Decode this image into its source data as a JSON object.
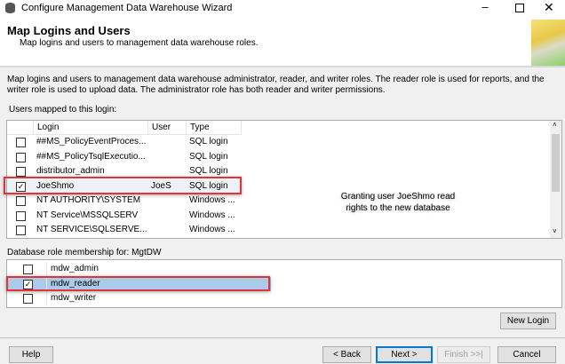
{
  "window": {
    "title": "Configure Management Data Warehouse Wizard"
  },
  "header": {
    "title": "Map Logins and Users",
    "subtitle": "Map logins and users to management data warehouse roles."
  },
  "description": "Map logins and users to management data warehouse administrator, reader, and writer roles. The reader role is used for reports, and the writer role is used to upload data. The administrator role has both reader and writer permissions.",
  "users_grid": {
    "label": "Users mapped to this login:",
    "columns": [
      "Login",
      "User",
      "Type"
    ],
    "rows": [
      {
        "checked": false,
        "login": "##MS_PolicyEventProces...",
        "user": "",
        "type": "SQL login"
      },
      {
        "checked": false,
        "login": "##MS_PolicyTsqlExecutio...",
        "user": "",
        "type": "SQL login"
      },
      {
        "checked": false,
        "login": "distributor_admin",
        "user": "",
        "type": "SQL login"
      },
      {
        "checked": true,
        "login": "JoeShmo",
        "user": "JoeS",
        "type": "SQL login"
      },
      {
        "checked": false,
        "login": "NT AUTHORITY\\SYSTEM",
        "user": "",
        "type": "Windows ..."
      },
      {
        "checked": false,
        "login": "NT Service\\MSSQLSERV",
        "user": "",
        "type": "Windows ..."
      },
      {
        "checked": false,
        "login": "NT SERVICE\\SQLSERVE...",
        "user": "",
        "type": "Windows ..."
      }
    ]
  },
  "annotation": {
    "line1": "Granting user JoeShmo read",
    "line2": "rights to the new database"
  },
  "roles_grid": {
    "label": "Database role membership for: MgtDW",
    "rows": [
      {
        "checked": false,
        "name": "mdw_admin"
      },
      {
        "checked": true,
        "name": "mdw_reader"
      },
      {
        "checked": false,
        "name": "mdw_writer"
      }
    ]
  },
  "buttons": {
    "new_login": "New Login",
    "help": "Help",
    "back": "< Back",
    "next": "Next >",
    "finish": "Finish >>|",
    "cancel": "Cancel"
  },
  "check_glyph": "✓",
  "colors": {
    "highlight": "#e0333a",
    "selection": "#aacbea"
  }
}
